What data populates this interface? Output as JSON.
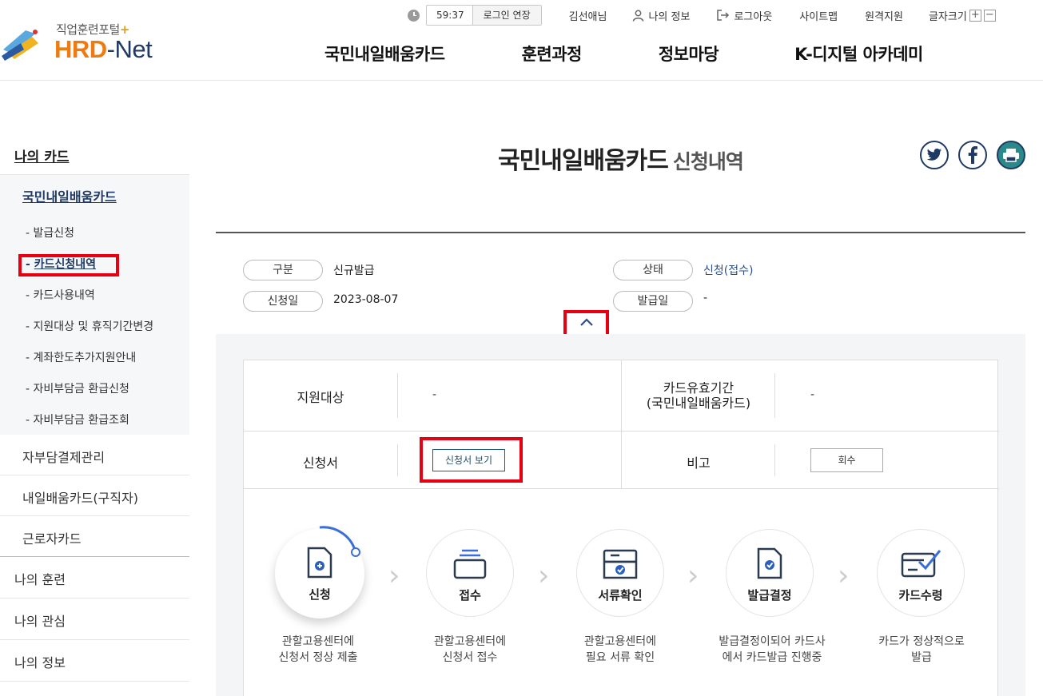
{
  "header": {
    "logo_sub": "직업훈련포털",
    "logo_plus": "+",
    "logo_hrd": "HRD",
    "logo_dash": "-",
    "logo_net": "Net",
    "timer": "59:37",
    "extend_login": "로그인 연장",
    "user_name": "김선애님",
    "my_info": "나의 정보",
    "logout": "로그아웃",
    "sitemap": "사이트맵",
    "remote": "원격지원",
    "font_size": "글자크기",
    "font_plus": "+",
    "font_minus": "−",
    "gnb": [
      "국민내일배움카드",
      "훈련과정",
      "정보마당",
      "K-디지털 아카데미"
    ]
  },
  "sidebar": {
    "top": "나의 카드",
    "current": "국민내일배움카드",
    "sub_items": [
      {
        "label": "발급신청"
      },
      {
        "label": "카드신청내역"
      },
      {
        "label": "카드사용내역"
      },
      {
        "label": "지원대상 및 휴직기간변경"
      },
      {
        "label": "계좌한도추가지원안내"
      },
      {
        "label": "자비부담금 환급신청"
      },
      {
        "label": "자비부담금 환급조회"
      }
    ],
    "items": [
      "자부담결제관리",
      "내일배움카드(구직자)",
      "근로자카드"
    ],
    "main": [
      "나의 훈련",
      "나의 관심",
      "나의 정보"
    ],
    "dash": "- "
  },
  "page": {
    "title": "국민내일배움카드",
    "subtitle": "신청내역"
  },
  "summary": {
    "type_label": "구분",
    "type_value": "신규발급",
    "status_label": "상태",
    "status_value": "신청(접수)",
    "apply_date_label": "신청일",
    "apply_date_value": "2023-08-07",
    "issue_date_label": "발급일",
    "issue_date_value": "-"
  },
  "detail": {
    "target_label": "지원대상",
    "target_value": "-",
    "validity_label_1": "카드유효기간",
    "validity_label_2": "(국민내일배움카드)",
    "validity_value": "-",
    "form_label": "신청서",
    "form_button": "신청서 보기",
    "note_label": "비고",
    "return_button": "회수"
  },
  "steps": [
    {
      "label": "신청",
      "desc1": "관할고용센터에",
      "desc2": "신청서 정상 제출",
      "icon": "document-plus-icon"
    },
    {
      "label": "접수",
      "desc1": "관할고용센터에",
      "desc2": "신청서 접수",
      "icon": "inbox-tray-icon"
    },
    {
      "label": "서류확인",
      "desc1": "관할고용센터에",
      "desc2": "필요 서류 확인",
      "icon": "folder-check-icon"
    },
    {
      "label": "발급결정",
      "desc1": "발급결정이되어 카드사",
      "desc2": "에서 카드발급 진행중",
      "icon": "document-check-icon"
    },
    {
      "label": "카드수령",
      "desc1": "카드가 정상적으로",
      "desc2": "발급",
      "icon": "card-check-icon"
    }
  ],
  "colors": {
    "navy": "#1f3a64",
    "orange": "#ee7a12",
    "highlight_red": "#e60012",
    "progress_blue": "#3a6fd8"
  }
}
